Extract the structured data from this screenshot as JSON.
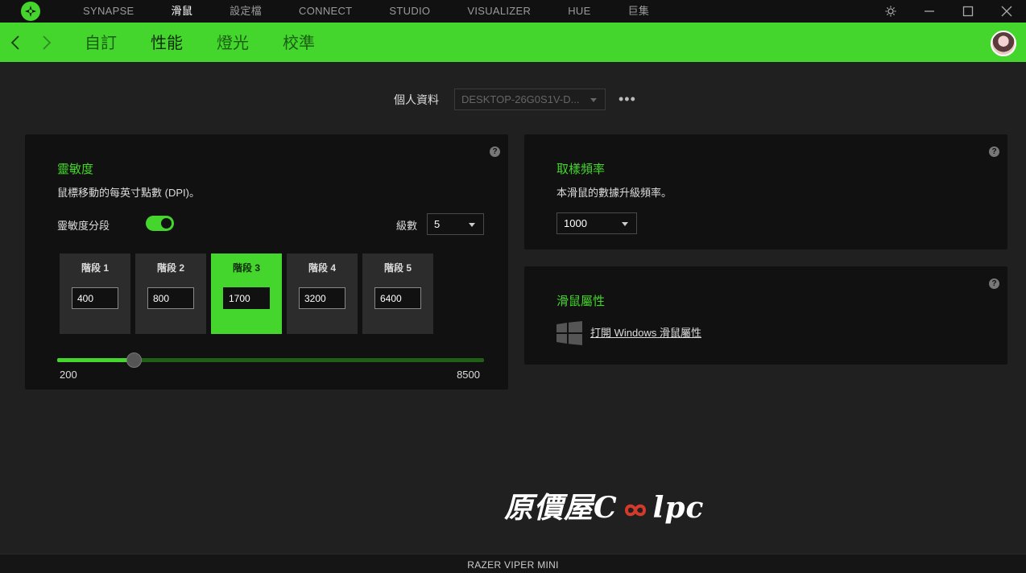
{
  "topnav": {
    "items": [
      "SYNAPSE",
      "滑鼠",
      "設定檔",
      "CONNECT",
      "STUDIO",
      "VISUALIZER",
      "HUE",
      "巨集"
    ],
    "active_index": 1
  },
  "subnav": {
    "tabs": [
      "自訂",
      "性能",
      "燈光",
      "校準"
    ],
    "active_index": 1
  },
  "profile": {
    "label": "個人資料",
    "selected": "DESKTOP-26G0S1V-D...",
    "more": "•••"
  },
  "sensitivity": {
    "title": "靈敏度",
    "description": "鼠標移動的每英寸點數 (DPI)。",
    "stages_toggle_label": "靈敏度分段",
    "stages_toggle_on": true,
    "levels_label": "級數",
    "levels_value": "5",
    "stages": [
      {
        "label": "階段 1",
        "value": "400"
      },
      {
        "label": "階段 2",
        "value": "800"
      },
      {
        "label": "階段 3",
        "value": "1700"
      },
      {
        "label": "階段 4",
        "value": "3200"
      },
      {
        "label": "階段 5",
        "value": "6400"
      }
    ],
    "active_stage": 2,
    "slider": {
      "min": "200",
      "max": "8500",
      "value": 1700
    }
  },
  "polling": {
    "title": "取樣頻率",
    "description": "本滑鼠的數據升級頻率。",
    "value": "1000"
  },
  "mouse_props": {
    "title": "滑鼠屬性",
    "link": "打開 Windows 滑鼠屬性"
  },
  "watermark": {
    "text_left": "原價屋C",
    "text_right": "lpc"
  },
  "device_name": "RAZER VIPER MINI",
  "help_icon": "?",
  "colors": {
    "accent": "#44d62c",
    "panel": "#111111",
    "background": "#202020"
  }
}
